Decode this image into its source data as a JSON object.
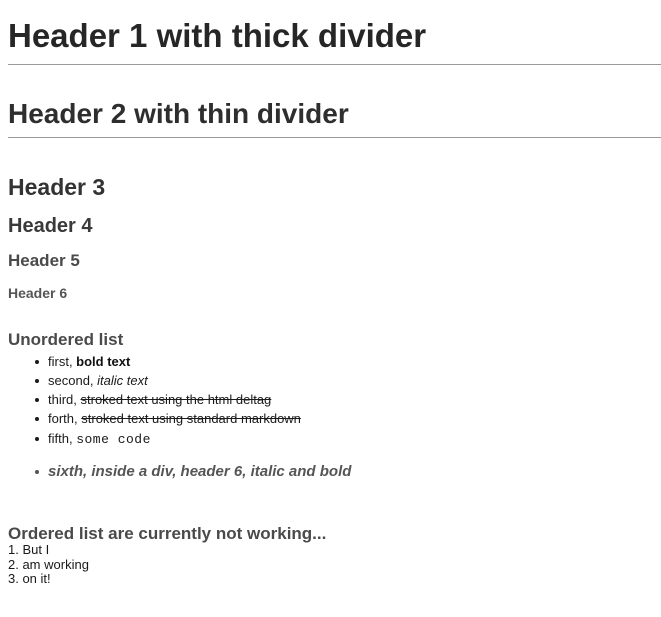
{
  "headings": {
    "h1": "Header 1 with thick divider",
    "h2": "Header 2 with thin divider",
    "h3": "Header 3",
    "h4": "Header 4",
    "h5": "Header 5",
    "h6": "Header 6"
  },
  "unordered_list": {
    "title": "Unordered list",
    "items": [
      {
        "prefix": "first, ",
        "text": "bold text"
      },
      {
        "prefix": "second, ",
        "text": "italic text"
      },
      {
        "prefix": "third, ",
        "text": "stroked text using the html deltag"
      },
      {
        "prefix": "forth, ",
        "text": "stroked text using standard markdown"
      },
      {
        "prefix": "fifth, ",
        "text": "some code"
      },
      {
        "text": "sixth, inside a div, header 6, italic and bold"
      }
    ]
  },
  "ordered_list": {
    "title": "Ordered list are currently not working...",
    "lines": [
      "1. But I",
      "2. am working",
      "3. on it!"
    ]
  }
}
